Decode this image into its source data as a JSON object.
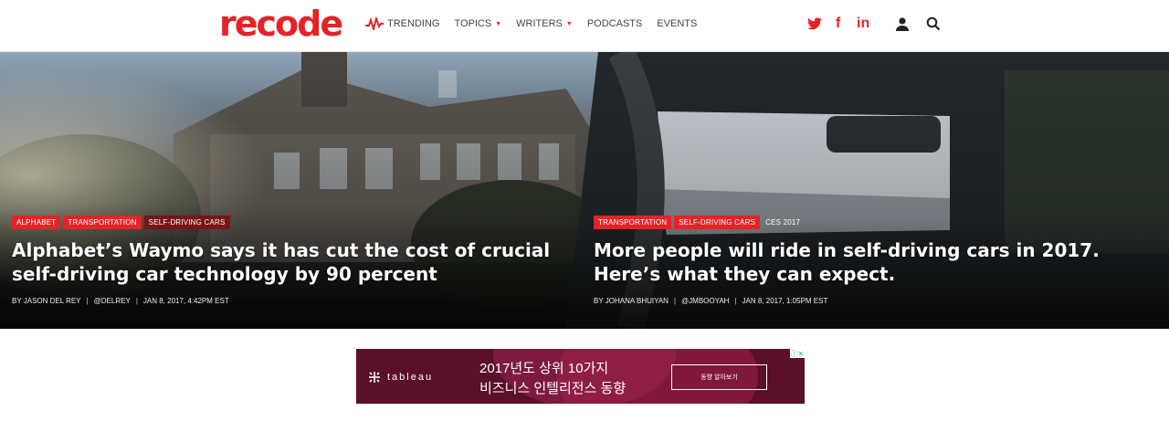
{
  "header": {
    "logo": "recode",
    "nav": [
      {
        "label": "TRENDING",
        "icon": "trending-icon"
      },
      {
        "label": "TOPICS",
        "caret": "▼"
      },
      {
        "label": "WRITERS",
        "caret": "▼"
      },
      {
        "label": "PODCASTS"
      },
      {
        "label": "EVENTS"
      }
    ],
    "social": {
      "twitter": "twitter-icon",
      "facebook": "f",
      "linkedin": "in"
    },
    "accent": "#e42327"
  },
  "stories": [
    {
      "tags": [
        "ALPHABET",
        "TRANSPORTATION",
        "SELF-DRIVING CARS"
      ],
      "headline": "Alphabet’s Waymo says it has cut the cost of crucial self-driving car technology by 90 percent",
      "author": "BY JASON DEL REY",
      "handle": "@DELREY",
      "date": "JAN 8, 2017, 4:42PM EST"
    },
    {
      "tags": [
        "TRANSPORTATION",
        "SELF-DRIVING CARS",
        "CES 2017"
      ],
      "headline": "More people will ride in self-driving cars in 2017. Here’s what they can expect.",
      "author": "BY JOHANA BHUIYAN",
      "handle": "@JMBOOYAH",
      "date": "JAN 8, 2017, 1:05PM EST"
    }
  ],
  "ad": {
    "brand": "tableau",
    "line1": "2017년도 상위 10가지",
    "line2": "비즈니스 인텔리전스 동향",
    "button": "동향 알아보기"
  }
}
